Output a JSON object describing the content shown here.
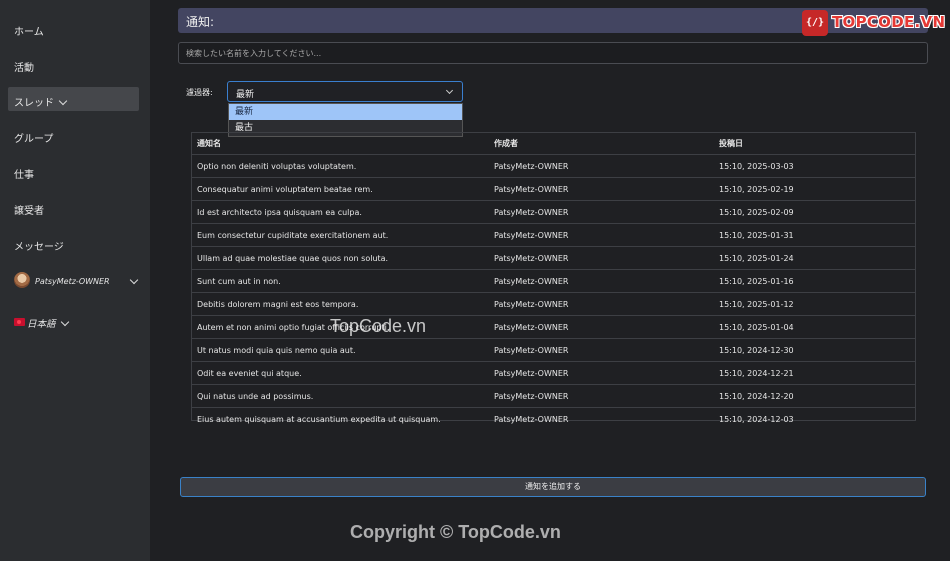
{
  "sidebar": {
    "items": [
      {
        "label": "ホーム"
      },
      {
        "label": "活動"
      },
      {
        "label": "スレッド"
      },
      {
        "label": "グループ"
      },
      {
        "label": "仕事"
      },
      {
        "label": "譲受者"
      },
      {
        "label": "メッセージ"
      }
    ],
    "user": {
      "name": "PatsyMetz-OWNER"
    },
    "language": {
      "label": "日本語"
    }
  },
  "header": {
    "title": "通知:"
  },
  "logo": {
    "mark": "{/}",
    "text": "TOPCODE.VN"
  },
  "search": {
    "placeholder": "検索したい名前を入力してください..."
  },
  "filter": {
    "label": "濾過器:",
    "selected": "最新",
    "options": [
      "最新",
      "最古"
    ]
  },
  "table": {
    "headers": [
      "通知名",
      "作成者",
      "投稿日"
    ],
    "rows": [
      [
        "Optio non deleniti voluptas voluptatem.",
        "PatsyMetz-OWNER",
        "15:10, 2025-03-03"
      ],
      [
        "Consequatur animi voluptatem beatae rem.",
        "PatsyMetz-OWNER",
        "15:10, 2025-02-19"
      ],
      [
        "Id est architecto ipsa quisquam ea culpa.",
        "PatsyMetz-OWNER",
        "15:10, 2025-02-09"
      ],
      [
        "Eum consectetur cupiditate exercitationem aut.",
        "PatsyMetz-OWNER",
        "15:10, 2025-01-31"
      ],
      [
        "Ullam ad quae molestiae quae quos non soluta.",
        "PatsyMetz-OWNER",
        "15:10, 2025-01-24"
      ],
      [
        "Sunt cum aut in non.",
        "PatsyMetz-OWNER",
        "15:10, 2025-01-16"
      ],
      [
        "Debitis dolorem magni est eos tempora.",
        "PatsyMetz-OWNER",
        "15:10, 2025-01-12"
      ],
      [
        "Autem et non animi optio fugiat officiis corrupti.",
        "PatsyMetz-OWNER",
        "15:10, 2025-01-04"
      ],
      [
        "Ut natus modi quia quis nemo quia aut.",
        "PatsyMetz-OWNER",
        "15:10, 2024-12-30"
      ],
      [
        "Odit ea eveniet qui atque.",
        "PatsyMetz-OWNER",
        "15:10, 2024-12-21"
      ],
      [
        "Qui natus unde ad possimus.",
        "PatsyMetz-OWNER",
        "15:10, 2024-12-20"
      ],
      [
        "Eius autem quisquam at accusantium expedita ut quisquam.",
        "PatsyMetz-OWNER",
        "15:10, 2024-12-03"
      ]
    ]
  },
  "add_button": {
    "label": "通知を追加する"
  },
  "watermarks": {
    "center": "TopCode.vn",
    "bottom": "Copyright © TopCode.vn"
  },
  "colors": {
    "accent": "#3a7fcf",
    "title_bar": "#434561",
    "selected_option": "#9ec5f8"
  }
}
